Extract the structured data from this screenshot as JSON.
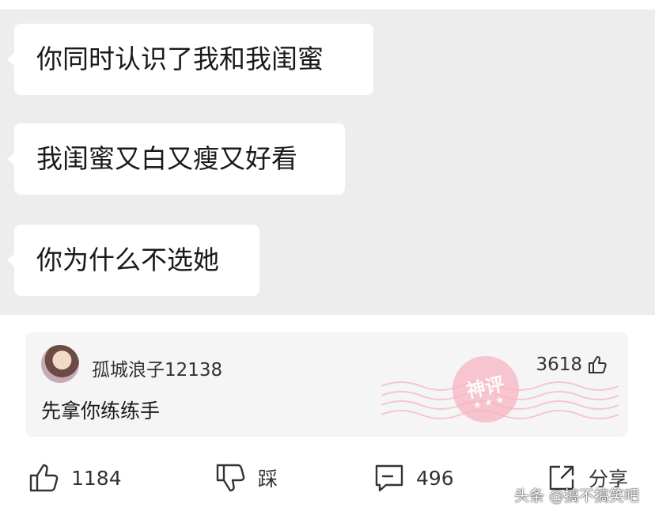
{
  "chat": {
    "messages": [
      {
        "text": "你同时认识了我和我闺蜜"
      },
      {
        "text": "我闺蜜又白又瘦又好看"
      },
      {
        "text": "你为什么不选她"
      }
    ]
  },
  "comment": {
    "username": "孤城浪子12138",
    "like_count": "3618",
    "text": "先拿你练练手",
    "stamp_text": "神评",
    "stamp_stars": "★ ★ ★"
  },
  "actions": {
    "like_count": "1184",
    "dislike_label": "踩",
    "comment_count": "496",
    "share_label": "分享"
  },
  "watermark": "头条 @搞不搞笑吧",
  "colors": {
    "chat_background": "#ededed",
    "bubble": "#ffffff",
    "stamp": "#f7b4c2"
  }
}
